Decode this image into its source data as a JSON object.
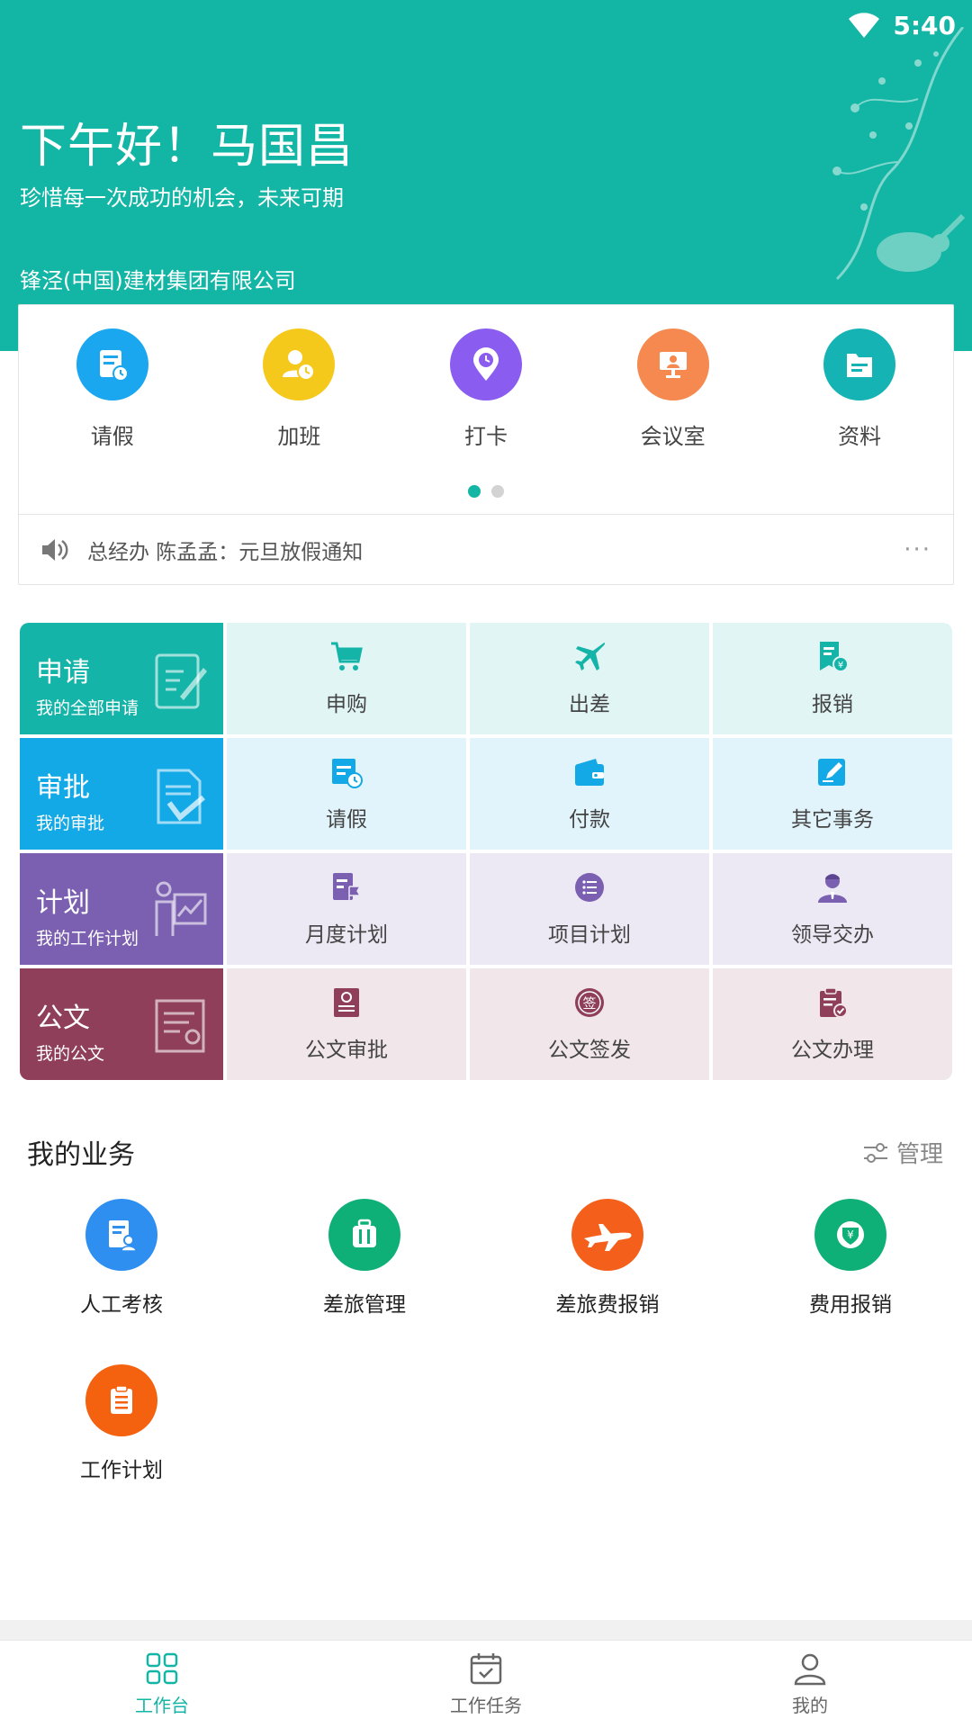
{
  "status_bar": {
    "time": "5:40"
  },
  "header": {
    "greeting": "下午好！马国昌",
    "motto": "珍惜每一次成功的机会，未来可期",
    "company": "锋泾(中国)建材集团有限公司"
  },
  "quick_actions": [
    {
      "label": "请假",
      "icon": "leave-form-icon",
      "color": "#1aa7ef"
    },
    {
      "label": "加班",
      "icon": "overtime-clock-user-icon",
      "color": "#f5c91b"
    },
    {
      "label": "打卡",
      "icon": "location-clock-icon",
      "color": "#8a5cf0"
    },
    {
      "label": "会议室",
      "icon": "meeting-room-icon",
      "color": "#f5894f"
    },
    {
      "label": "资料",
      "icon": "folder-icon",
      "color": "#16b3b4"
    }
  ],
  "carousel": {
    "pages": 2,
    "current": 1
  },
  "notice": {
    "text": "总经办 陈孟孟：元旦放假通知",
    "more": "···"
  },
  "matrix": {
    "rows": [
      {
        "title": "申请",
        "subtitle": "我的全部申请",
        "color": "#15b4a8",
        "items": [
          {
            "label": "申购",
            "icon": "cart-icon"
          },
          {
            "label": "出差",
            "icon": "airplane-icon"
          },
          {
            "label": "报销",
            "icon": "reimburse-doc-icon"
          }
        ]
      },
      {
        "title": "审批",
        "subtitle": "我的审批",
        "color": "#12a9e6",
        "items": [
          {
            "label": "请假",
            "icon": "leave-calendar-icon"
          },
          {
            "label": "付款",
            "icon": "wallet-icon"
          },
          {
            "label": "其它事务",
            "icon": "edit-note-icon"
          }
        ]
      },
      {
        "title": "计划",
        "subtitle": "我的工作计划",
        "color": "#7b5fb0",
        "items": [
          {
            "label": "月度计划",
            "icon": "flag-doc-icon"
          },
          {
            "label": "项目计划",
            "icon": "list-circle-icon"
          },
          {
            "label": "领导交办",
            "icon": "leader-icon"
          }
        ]
      },
      {
        "title": "公文",
        "subtitle": "我的公文",
        "color": "#8f3f59",
        "items": [
          {
            "label": "公文审批",
            "icon": "official-doc-icon"
          },
          {
            "label": "公文签发",
            "icon": "sign-seal-icon"
          },
          {
            "label": "公文办理",
            "icon": "clipboard-check-icon"
          }
        ]
      }
    ],
    "sign_char": "签"
  },
  "business": {
    "title": "我的业务",
    "manage_label": "管理",
    "items": [
      {
        "label": "人工考核",
        "icon": "assessment-icon",
        "color": "#2e8ff0"
      },
      {
        "label": "差旅管理",
        "icon": "luggage-icon",
        "color": "#0fb077"
      },
      {
        "label": "差旅费报销",
        "icon": "plane-icon",
        "color": "#f55f1c"
      },
      {
        "label": "费用报销",
        "icon": "yen-shield-icon",
        "color": "#0fb077"
      },
      {
        "label": "工作计划",
        "icon": "clipboard-icon",
        "color": "#f5620f"
      }
    ]
  },
  "bottom_nav": [
    {
      "label": "工作台",
      "icon": "grid-icon",
      "active": true
    },
    {
      "label": "工作任务",
      "icon": "calendar-check-icon",
      "active": false
    },
    {
      "label": "我的",
      "icon": "user-icon",
      "active": false
    }
  ]
}
